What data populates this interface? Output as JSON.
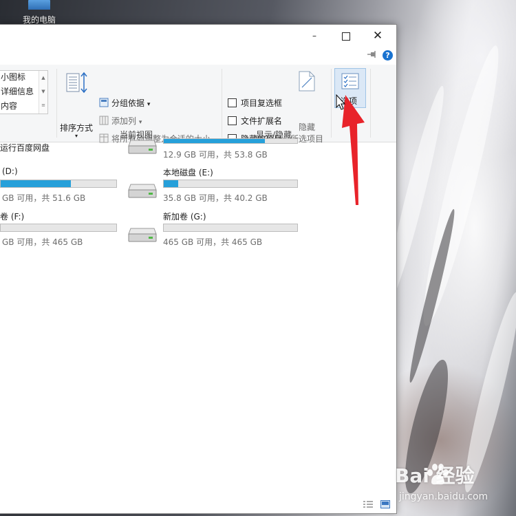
{
  "desktop": {
    "icon_label": "我的电脑"
  },
  "window": {
    "controls": {
      "minimize": "–",
      "maximize": "□",
      "close": "✕"
    },
    "help": "?"
  },
  "ribbon": {
    "layout_items": [
      "小图标",
      "详细信息",
      "内容"
    ],
    "sort_label": "排序方式",
    "group_by": "分组依据",
    "add_columns": "添加列",
    "size_columns": "将所有列调整为合适的大小",
    "current_view_label": "当前视图",
    "checkboxes": [
      "项目复选框",
      "文件扩展名",
      "隐藏的项目"
    ],
    "hide_selected_top": "隐藏",
    "hide_selected_bottom": "所选项目",
    "show_hide_label": "显示/隐藏",
    "options_label": "选项"
  },
  "content": {
    "baidu_netdisk": "运行百度网盘",
    "drives": [
      {
        "name": "",
        "size": "12.9 GB 可用，共 53.8 GB",
        "used_fraction": 0.76
      },
      {
        "name": "(D:)",
        "size": "GB 可用，共 51.6 GB",
        "used_fraction": 0.61
      },
      {
        "name": "本地磁盘 (E:)",
        "size": "35.8 GB 可用，共 40.2 GB",
        "used_fraction": 0.11
      },
      {
        "name": "卷 (F:)",
        "size": "GB 可用，共 465 GB",
        "used_fraction": 0.0
      },
      {
        "name": "新加卷 (G:)",
        "size": "465 GB 可用，共 465 GB",
        "used_fraction": 0.0
      }
    ]
  },
  "watermark": {
    "brand": "Bai  经验",
    "url": "jingyan.baidu.com"
  },
  "colors": {
    "accent": "#26a0da",
    "arrow": "#e8232a",
    "options_highlight": "#dbe8f6"
  }
}
